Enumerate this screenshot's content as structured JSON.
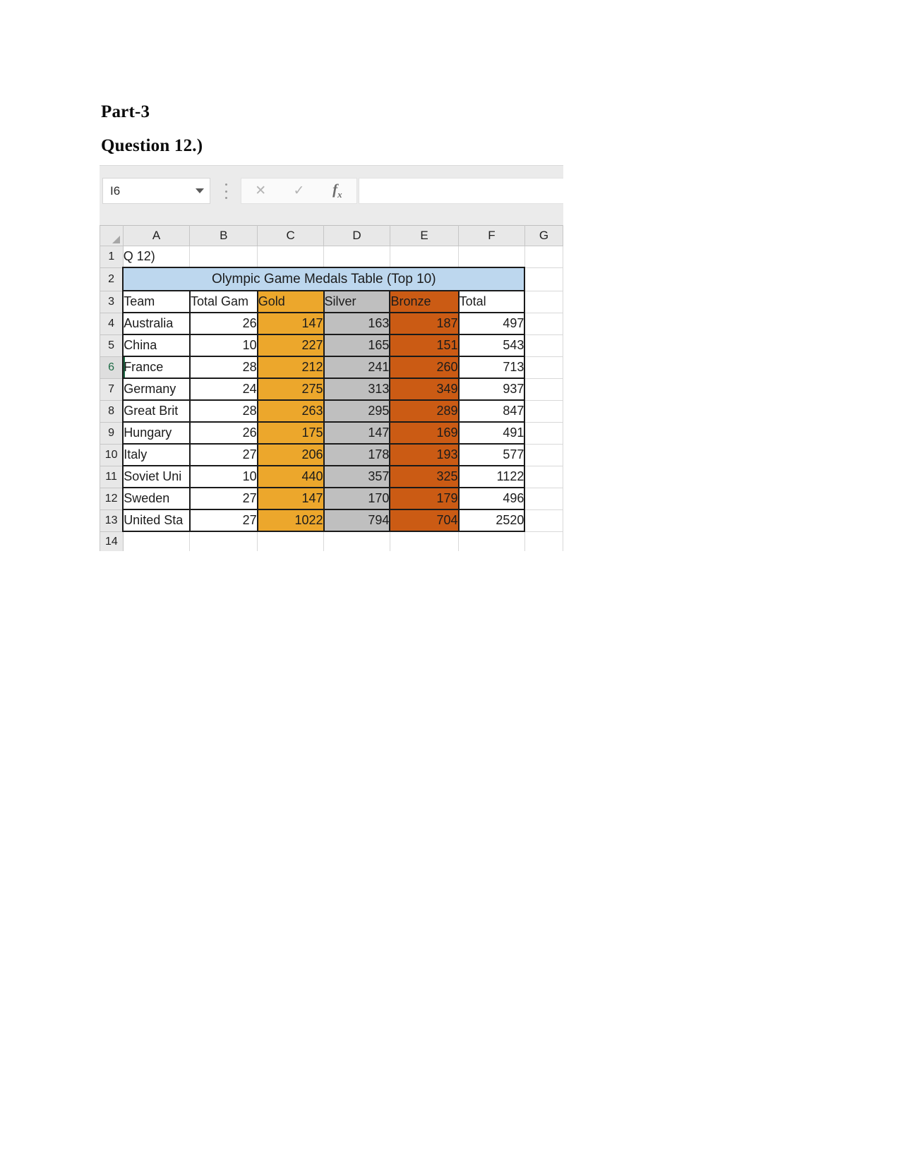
{
  "document": {
    "part_heading": "Part-3",
    "question_heading": "Question 12.)"
  },
  "spreadsheet": {
    "name_box": {
      "value": "I6",
      "dropdown_icon": "chevron-down-icon"
    },
    "formula_bar": {
      "cancel_icon": "close-icon",
      "confirm_icon": "check-icon",
      "function_icon": "fx-icon",
      "value": ""
    },
    "column_headers": [
      "A",
      "B",
      "C",
      "D",
      "E",
      "F",
      "G"
    ],
    "row_headers": [
      "1",
      "2",
      "3",
      "4",
      "5",
      "6",
      "7",
      "8",
      "9",
      "10",
      "11",
      "12",
      "13",
      "14"
    ],
    "active_row": "6",
    "cells": {
      "a1": "Q 12)",
      "title": "Olympic Game Medals Table (Top 10)"
    },
    "colors": {
      "title_fill": "#BDD7EE",
      "gold_fill": "#ECA72C",
      "silver_fill": "#BFBFBF",
      "bronze_fill": "#CB5B14",
      "header_gray": "#E8E8E8",
      "grid_line": "#D8D8D8",
      "table_border": "#1A1A1A",
      "active_green": "#1D6B45"
    }
  },
  "chart_data": {
    "type": "table",
    "title": "Olympic Game Medals Table (Top 10)",
    "columns": [
      "Team",
      "Total Gam",
      "Gold",
      "Silver",
      "Bronze",
      "Total"
    ],
    "rows": [
      {
        "team": "Australia",
        "total_games": "26",
        "gold": "147",
        "silver": "163",
        "bronze": "187",
        "total": "497"
      },
      {
        "team": "China",
        "total_games": "10",
        "gold": "227",
        "silver": "165",
        "bronze": "151",
        "total": "543"
      },
      {
        "team": "France",
        "total_games": "28",
        "gold": "212",
        "silver": "241",
        "bronze": "260",
        "total": "713"
      },
      {
        "team": "Germany",
        "total_games": "24",
        "gold": "275",
        "silver": "313",
        "bronze": "349",
        "total": "937"
      },
      {
        "team": "Great Brit",
        "total_games": "28",
        "gold": "263",
        "silver": "295",
        "bronze": "289",
        "total": "847"
      },
      {
        "team": "Hungary",
        "total_games": "26",
        "gold": "175",
        "silver": "147",
        "bronze": "169",
        "total": "491"
      },
      {
        "team": "Italy",
        "total_games": "27",
        "gold": "206",
        "silver": "178",
        "bronze": "193",
        "total": "577"
      },
      {
        "team": "Soviet Uni",
        "total_games": "10",
        "gold": "440",
        "silver": "357",
        "bronze": "325",
        "total": "1122"
      },
      {
        "team": "Sweden",
        "total_games": "27",
        "gold": "147",
        "silver": "170",
        "bronze": "179",
        "total": "496"
      },
      {
        "team": "United Sta",
        "total_games": "27",
        "gold": "1022",
        "silver": "794",
        "bronze": "704",
        "total": "2520"
      }
    ]
  }
}
